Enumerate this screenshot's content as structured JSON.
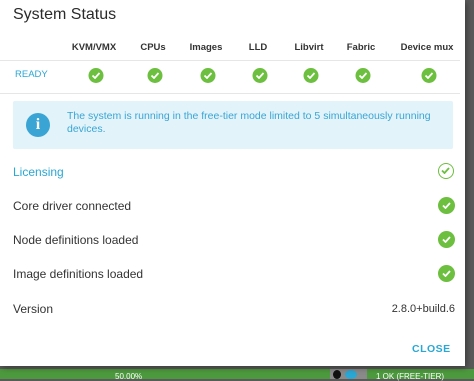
{
  "dialog": {
    "title": "System Status",
    "close_label": "CLOSE"
  },
  "status_table": {
    "columns": [
      "KVM/VMX",
      "CPUs",
      "Images",
      "LLD",
      "Libvirt",
      "Fabric",
      "Device mux"
    ],
    "row_label": "READY",
    "all_ok": true
  },
  "info_message": {
    "icon": "info-icon",
    "text": "The system is running in the free-tier mode limited to 5 simultaneously running devices."
  },
  "status_rows": [
    {
      "label": "Licensing",
      "ok": true,
      "style": "link"
    },
    {
      "label": "Core driver connected",
      "ok": true
    },
    {
      "label": "Node definitions loaded",
      "ok": true
    },
    {
      "label": "Image definitions loaded",
      "ok": true
    }
  ],
  "version": {
    "label": "Version",
    "value": "2.8.0+build.6"
  },
  "background_bar": {
    "left_text": "50.00%",
    "right_text": "1 OK (FREE-TIER)"
  },
  "colors": {
    "accent": "#2aa7d4",
    "success": "#6cbf3f",
    "info_bg": "#e2f3fa"
  }
}
